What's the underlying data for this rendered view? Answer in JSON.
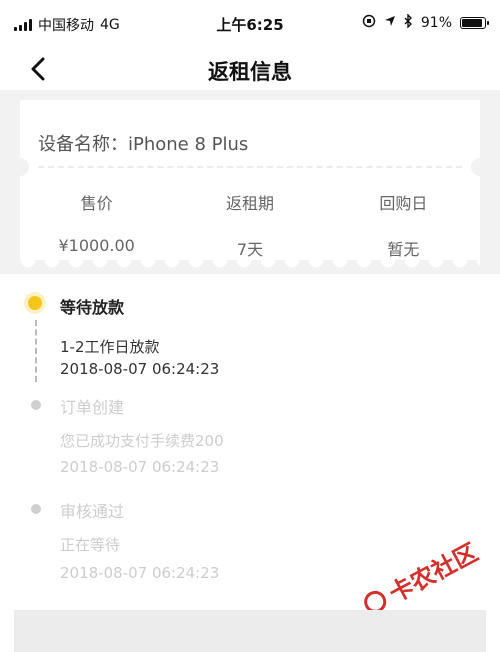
{
  "status_bar": {
    "carrier": "中国移动",
    "network": "4G",
    "time": "上午6:25",
    "battery_percent": "91%",
    "battery_level": 0.91
  },
  "nav": {
    "title": "返租信息"
  },
  "device": {
    "label": "设备名称：",
    "name": "iPhone 8 Plus"
  },
  "details": [
    {
      "label": "售价",
      "value": "¥1000.00"
    },
    {
      "label": "返租期",
      "value": "7天"
    },
    {
      "label": "回购日",
      "value": "暂无"
    }
  ],
  "timeline": [
    {
      "title": "等待放款",
      "desc": "1-2工作日放款",
      "time": "2018-08-07 06:24:23",
      "status": "active"
    },
    {
      "title": "订单创建",
      "desc": "您已成功支付手续费200",
      "time": "2018-08-07 06:24:23",
      "status": "done"
    },
    {
      "title": "审核通过",
      "desc": "正在等待",
      "time": "2018-08-07 06:24:23",
      "status": "done"
    }
  ],
  "watermark": {
    "text": "卡农社区"
  },
  "colors": {
    "accent": "#f5c518",
    "watermark": "#d4302b"
  }
}
